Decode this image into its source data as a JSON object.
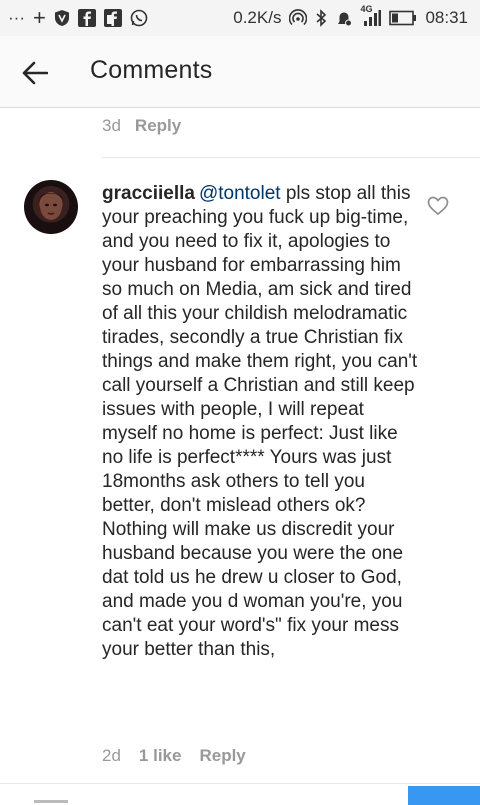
{
  "status_bar": {
    "left_glyphs": [
      "···",
      "+"
    ],
    "speed": "0.2K/s",
    "signal_label": "4G",
    "time": "08:31"
  },
  "header": {
    "title": "Comments"
  },
  "previous_comment": {
    "time": "3d",
    "reply_label": "Reply"
  },
  "comment": {
    "username": "gracciiella",
    "mention": "@tontolet",
    "text": " pls stop all this your preaching you fuck up big-time, and you need to fix it, apologies to your husband for embarrassing him so much on Media, am sick and tired of all this your childish  melodramatic tirades, secondly a true Christian fix things and make them right, you can't call yourself a Christian and still keep issues with people, I will repeat myself no home is perfect: Just like no life is perfect**** Yours was just 18months ask others to tell you better, don't mislead others ok? Nothing will make us discredit your husband because you were the one dat told us he drew u closer to God, and made you d woman you're, you can't eat your word's\" fix your mess your better than this,",
    "time": "2d",
    "likes": "1 like",
    "reply_label": "Reply"
  },
  "icons": {
    "back": "arrow-left-icon",
    "like": "heart-outline-icon"
  },
  "colors": {
    "mention": "#003569",
    "meta": "#999999",
    "accent": "#3897f0"
  }
}
